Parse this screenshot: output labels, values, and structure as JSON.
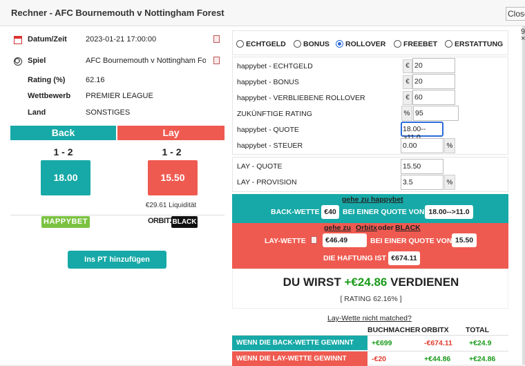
{
  "window": {
    "title": "Rechner - AFC Bournemouth v Nottingham Forest",
    "close_label": "Close"
  },
  "info": {
    "datetime": {
      "label": "Datum/Zeit",
      "value": "2023-01-21 17:00:00"
    },
    "game": {
      "label": "Spiel",
      "value": "AFC Bournemouth v Nottingham Forest"
    },
    "rating": {
      "label": "Rating (%)",
      "value": "62.16"
    },
    "competition": {
      "label": "Wettbewerb",
      "value": "PREMIER LEAGUE"
    },
    "country": {
      "label": "Land",
      "value": "SONSTIGES"
    }
  },
  "back": {
    "header": "Back",
    "score": "1 - 2",
    "odds": "18.00",
    "color": "#17a9a7",
    "bookmaker_logo": "HAPPYBET"
  },
  "lay": {
    "header": "Lay",
    "score": "1 - 2",
    "odds": "15.50",
    "liquidity": "€29.61 Liquidität",
    "color": "#ef5a50",
    "exchange_logo_text": "ORBITX",
    "exchange_logo_badge": "BLACK"
  },
  "add_pt_button": "Ins PT hinzufügen",
  "bet_types": {
    "selected": "ROLLOVER",
    "options": [
      "ECHTGELD",
      "BONUS",
      "ROLLOVER",
      "FREEBET",
      "ERSTATTUNG"
    ]
  },
  "form": {
    "cash": {
      "label": "happybet - ECHTGELD",
      "unit": "€",
      "value": "20"
    },
    "bonus": {
      "label": "happybet - BONUS",
      "unit": "€",
      "value": "20"
    },
    "rollover": {
      "label": "happybet - VERBLIEBENE ROLLOVER",
      "unit": "€",
      "value": "60"
    },
    "future_rating": {
      "label": "ZUKÜNFTIGE RATING",
      "unit": "%",
      "value": "95"
    },
    "back_odds": {
      "label": "happybet - QUOTE",
      "value": "18.00-->11.0"
    },
    "tax": {
      "label": "happybet - STEUER",
      "value": "0.00",
      "unit": "%"
    },
    "lay_odds": {
      "label": "LAY - QUOTE",
      "value": "15.50"
    },
    "commission": {
      "label": "LAY - PROVISION",
      "value": "3.5",
      "unit": "%"
    }
  },
  "back_summary": {
    "link": "gehe zu happybet",
    "prefix": "BACK-WETTE",
    "stake": "€40",
    "middle": "BEI EINER QUOTE VON",
    "odds": "18.00-->11.0"
  },
  "lay_summary": {
    "link_prefix": "gehe zu",
    "link_orbitx": "Orbitx",
    "link_or": "oder",
    "link_black": "BLACK",
    "prefix": "LAY-WETTE",
    "stake": "€46.49",
    "middle": "BEI EINER QUOTE VON",
    "odds": "15.50",
    "liability_label": "DIE HAFTUNG IST",
    "liability": "€674.11"
  },
  "result": {
    "prefix": "DU WIRST",
    "amount": "+€24.86",
    "suffix": "VERDIENEN",
    "rating_line": "[ RATING 62.16% ]"
  },
  "not_matched_link": "Lay-Wette nicht matched?",
  "table": {
    "headers": [
      "BUCHMACHER",
      "ORBITX",
      "TOTAL"
    ],
    "rows": [
      {
        "label": "WENN DIE BACK-WETTE GEWINNT",
        "values": [
          "+€699",
          "-€674.11",
          "+€24.9"
        ]
      },
      {
        "label": "WENN DIE LAY-WETTE GEWINNT",
        "values": [
          "-€20",
          "+€44.86",
          "+€24.86"
        ]
      }
    ]
  },
  "colors": {
    "back": "#17a9a7",
    "lay": "#ef5a50",
    "positive": "#1a9b1a",
    "negative": "#e23b2e",
    "focus": "#2a6ad8"
  }
}
